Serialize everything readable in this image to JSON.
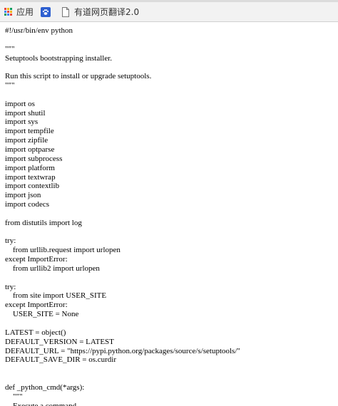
{
  "bookmarks_bar": {
    "items": [
      {
        "label": "应用",
        "icon": "apps-grid-icon"
      },
      {
        "label": "",
        "icon": "baidu-paw-icon"
      },
      {
        "label": "有道网页翻译2.0",
        "icon": "page-icon"
      }
    ]
  },
  "document": {
    "text": "#!/usr/bin/env python\n\n\"\"\"\nSetuptools bootstrapping installer.\n\nRun this script to install or upgrade setuptools.\n\"\"\"\n\nimport os\nimport shutil\nimport sys\nimport tempfile\nimport zipfile\nimport optparse\nimport subprocess\nimport platform\nimport textwrap\nimport contextlib\nimport json\nimport codecs\n\nfrom distutils import log\n\ntry:\n    from urllib.request import urlopen\nexcept ImportError:\n    from urllib2 import urlopen\n\ntry:\n    from site import USER_SITE\nexcept ImportError:\n    USER_SITE = None\n\nLATEST = object()\nDEFAULT_VERSION = LATEST\nDEFAULT_URL = \"https://pypi.python.org/packages/source/s/setuptools/\"\nDEFAULT_SAVE_DIR = os.curdir\n\n\ndef _python_cmd(*args):\n    \"\"\"\n    Execute a command."
  },
  "colors": {
    "bookmarks_bg": "#f2f2f2",
    "page_bg": "#ffffff",
    "text": "#000000",
    "paw_icon": "#2d5fd0"
  }
}
